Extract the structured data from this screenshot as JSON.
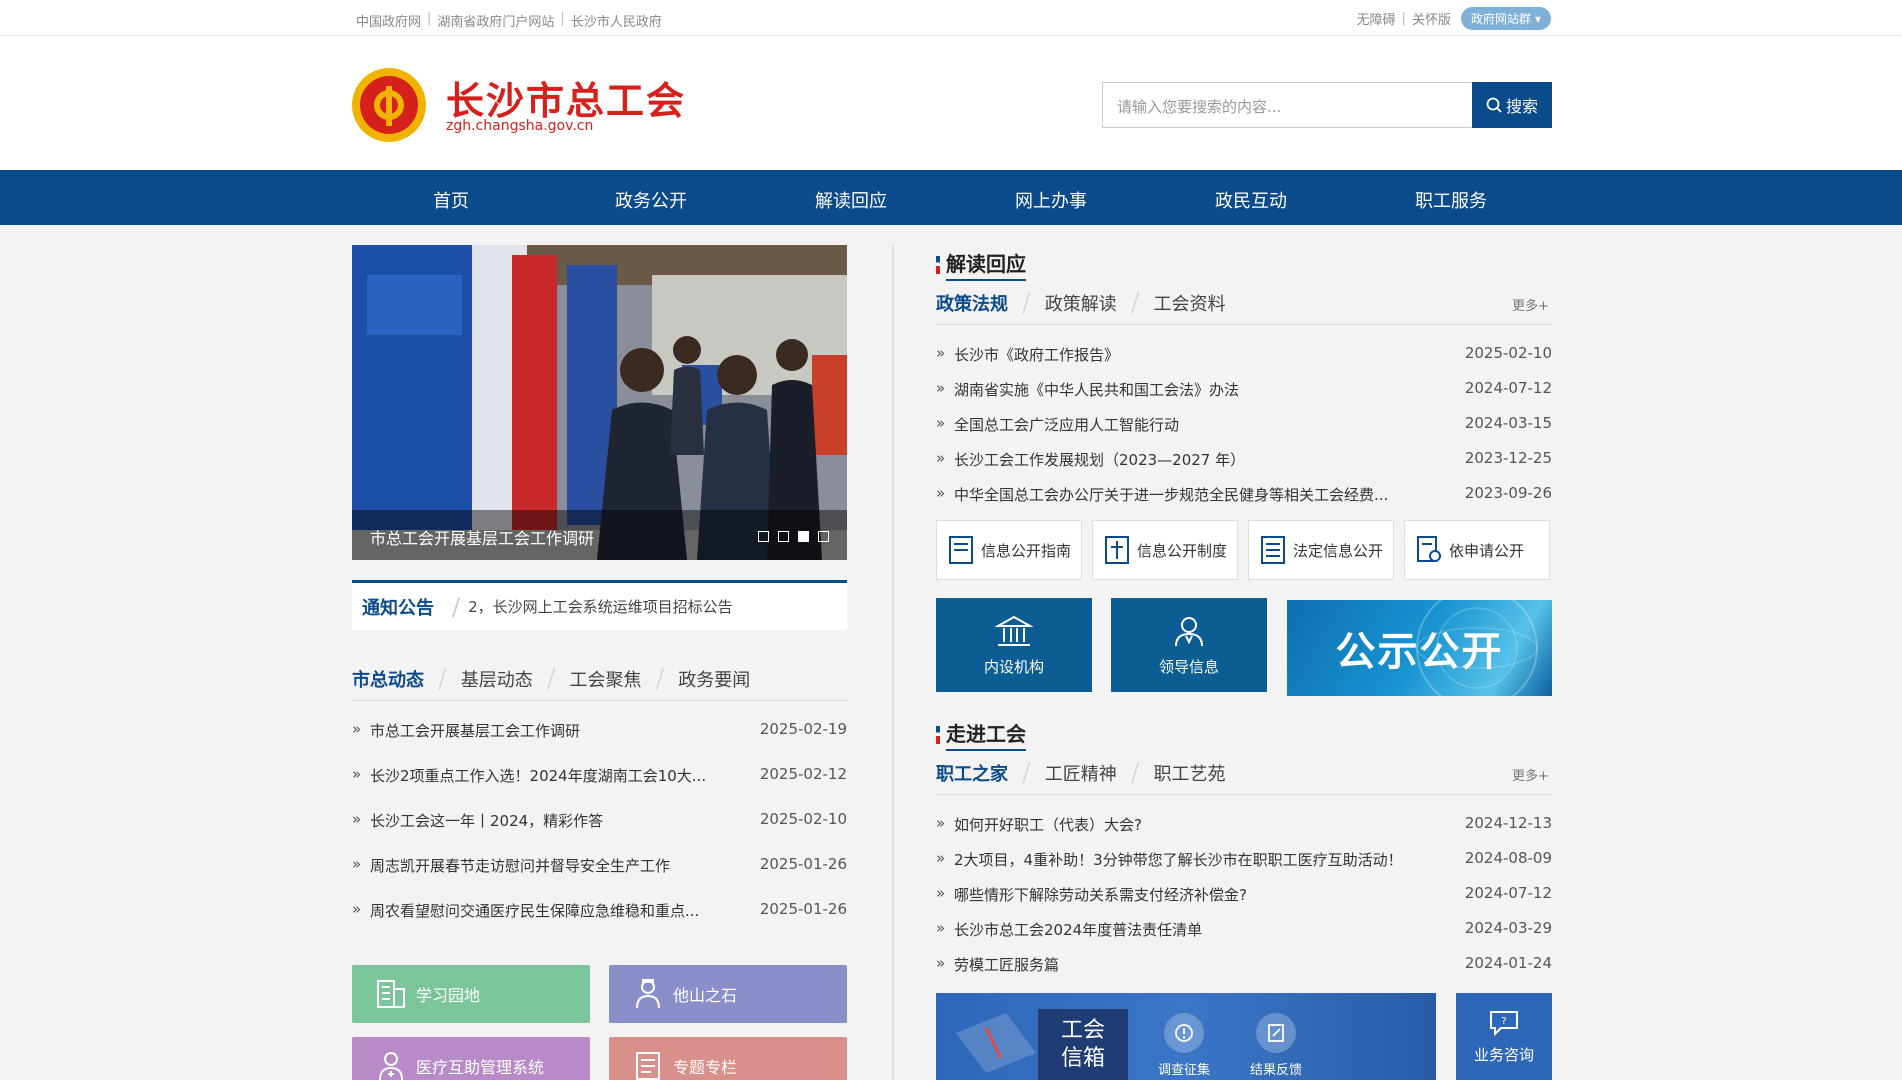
{
  "topbar": {
    "links": [
      "中国政府网",
      "湖南省政府门户网站",
      "长沙市人民政府"
    ],
    "accessibility": "无障碍",
    "care_mode": "关怀版",
    "site_group": "政府网站群"
  },
  "header": {
    "title": "长沙市总工会",
    "url": "zgh.changsha.gov.cn",
    "search_placeholder": "请输入您要搜索的内容...",
    "search_button": "搜索"
  },
  "nav": [
    "首页",
    "政务公开",
    "解读回应",
    "网上办事",
    "政民互动",
    "职工服务"
  ],
  "slider": {
    "caption": "市总工会开展基层工会工作调研",
    "dots": 4,
    "active_dot": 3
  },
  "notice": {
    "label": "通知公告",
    "text": "2，长沙网上工会系统运维项目招标公告"
  },
  "news": {
    "tabs": [
      "市总动态",
      "基层动态",
      "工会聚焦",
      "政务要闻"
    ],
    "items": [
      {
        "title": "市总工会开展基层工会工作调研",
        "date": "2025-02-19"
      },
      {
        "title": "长沙2项重点工作入选！2024年度湖南工会10大...",
        "date": "2025-02-12"
      },
      {
        "title": "长沙工会这一年丨2024，精彩作答",
        "date": "2025-02-10"
      },
      {
        "title": "周志凯开展春节走访慰问并督导安全生产工作",
        "date": "2025-01-26"
      },
      {
        "title": "周农看望慰问交通医疗民生保障应急维稳和重点...",
        "date": "2025-01-26"
      }
    ]
  },
  "quick_links": [
    {
      "label": "学习园地",
      "color": "#7cc49a",
      "icon": "building-icon"
    },
    {
      "label": "他山之石",
      "color": "#8a8fca",
      "icon": "worker-icon"
    },
    {
      "label": "医疗互助管理系统",
      "color": "#b88ac8",
      "icon": "doctor-icon"
    },
    {
      "label": "专题专栏",
      "color": "#d9908a",
      "icon": "document-icon"
    }
  ],
  "interpret": {
    "heading": "解读回应",
    "tabs": [
      "政策法规",
      "政策解读",
      "工会资料"
    ],
    "more": "更多+",
    "items": [
      {
        "title": "长沙市《政府工作报告》",
        "date": "2025-02-10"
      },
      {
        "title": "湖南省实施《中华人民共和国工会法》办法",
        "date": "2024-07-12"
      },
      {
        "title": "全国总工会广泛应用人工智能行动",
        "date": "2024-03-15"
      },
      {
        "title": "长沙工会工作发展规划（2023—2027 年）",
        "date": "2023-12-25"
      },
      {
        "title": "中华全国总工会办公厅关于进一步规范全民健身等相关工会经费...",
        "date": "2023-09-26"
      }
    ]
  },
  "info_buttons": [
    "信息公开指南",
    "信息公开制度",
    "法定信息公开",
    "依申请公开"
  ],
  "tiles": [
    "内设机构",
    "领导信息"
  ],
  "banner": "公示公开",
  "union": {
    "heading": "走进工会",
    "tabs": [
      "职工之家",
      "工匠精神",
      "职工艺苑"
    ],
    "more": "更多+",
    "items": [
      {
        "title": "如何开好职工（代表）大会?",
        "date": "2024-12-13"
      },
      {
        "title": "2大项目，4重补助！3分钟带您了解长沙市在职职工医疗互助活动！",
        "date": "2024-08-09"
      },
      {
        "title": "哪些情形下解除劳动关系需支付经济补偿金?",
        "date": "2024-07-12"
      },
      {
        "title": "长沙市总工会2024年度普法责任清单",
        "date": "2024-03-29"
      },
      {
        "title": "劳模工匠服务篇",
        "date": "2024-01-24"
      }
    ]
  },
  "mailbox": {
    "title_line1": "工会",
    "title_line2": "信箱",
    "survey": "调查征集",
    "feedback": "结果反馈",
    "consult": "业务咨询"
  }
}
